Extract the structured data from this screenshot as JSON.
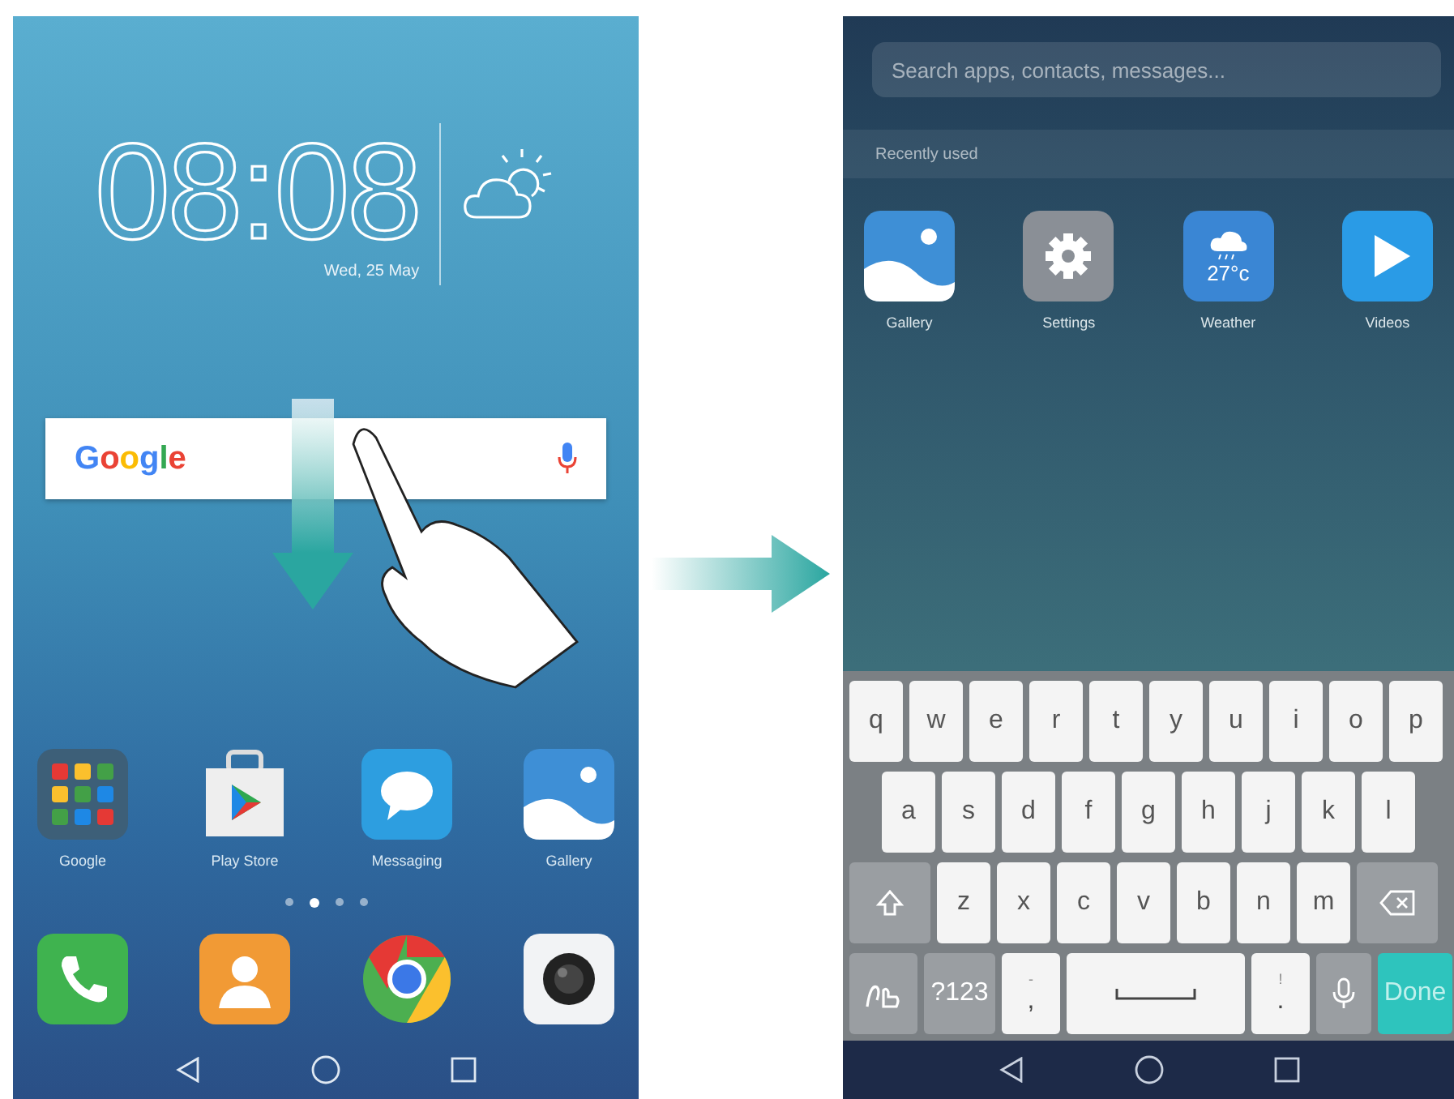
{
  "home_screen": {
    "clock": {
      "time": "08:08",
      "date": "Wed, 25 May"
    },
    "search_widget": {
      "logo": "Google"
    },
    "apps": [
      {
        "label": "Google"
      },
      {
        "label": "Play Store"
      },
      {
        "label": "Messaging"
      },
      {
        "label": "Gallery"
      }
    ],
    "page_dots": [
      {
        "selected": false
      },
      {
        "selected": true
      },
      {
        "selected": false
      },
      {
        "selected": false
      }
    ]
  },
  "search_screen": {
    "search": {
      "placeholder": "Search apps, contacts, messages..."
    },
    "section": "Recently used",
    "apps": [
      {
        "label": "Gallery"
      },
      {
        "label": "Settings"
      },
      {
        "label": "Weather",
        "reading": "27°c"
      },
      {
        "label": "Videos"
      }
    ],
    "keyboard": {
      "rows": [
        {
          "keys": [
            {
              "kind": "letter",
              "label": "q"
            },
            {
              "kind": "letter",
              "label": "w"
            },
            {
              "kind": "letter",
              "label": "e"
            },
            {
              "kind": "letter",
              "label": "r"
            },
            {
              "kind": "letter",
              "label": "t"
            },
            {
              "kind": "letter",
              "label": "y"
            },
            {
              "kind": "letter",
              "label": "u"
            },
            {
              "kind": "letter",
              "label": "i"
            },
            {
              "kind": "letter",
              "label": "o"
            },
            {
              "kind": "letter",
              "label": "p"
            }
          ]
        },
        {
          "keys": [
            {
              "kind": "letter",
              "label": "a"
            },
            {
              "kind": "letter",
              "label": "s"
            },
            {
              "kind": "letter",
              "label": "d"
            },
            {
              "kind": "letter",
              "label": "f"
            },
            {
              "kind": "letter",
              "label": "g"
            },
            {
              "kind": "letter",
              "label": "h"
            },
            {
              "kind": "letter",
              "label": "j"
            },
            {
              "kind": "letter",
              "label": "k"
            },
            {
              "kind": "letter",
              "label": "l"
            }
          ]
        },
        {
          "keys": [
            {
              "kind": "shift"
            },
            {
              "kind": "letter",
              "label": "z"
            },
            {
              "kind": "letter",
              "label": "x"
            },
            {
              "kind": "letter",
              "label": "c"
            },
            {
              "kind": "letter",
              "label": "v"
            },
            {
              "kind": "letter",
              "label": "b"
            },
            {
              "kind": "letter",
              "label": "n"
            },
            {
              "kind": "letter",
              "label": "m"
            },
            {
              "kind": "backspace"
            }
          ]
        },
        {
          "keys": [
            {
              "kind": "handwriting"
            },
            {
              "kind": "symbols",
              "label": "?123"
            },
            {
              "kind": "punct",
              "label": ",",
              "hint": "-"
            },
            {
              "kind": "space"
            },
            {
              "kind": "punct",
              "label": ".",
              "hint": "!"
            },
            {
              "kind": "mic"
            },
            {
              "kind": "done",
              "label": "Done"
            }
          ]
        }
      ]
    }
  }
}
